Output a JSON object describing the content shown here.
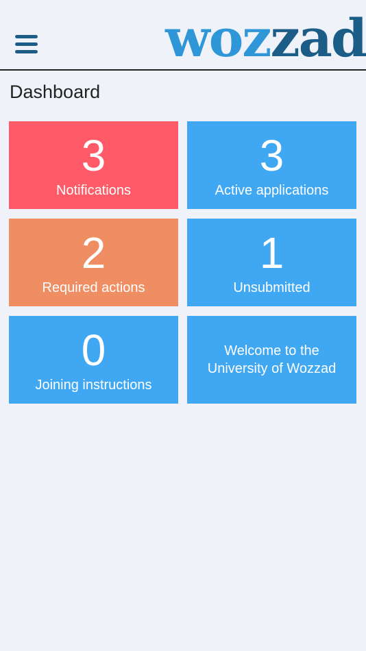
{
  "logo": {
    "part1": "woz",
    "part2": "zad"
  },
  "header": {
    "menu_icon": "hamburger-menu-icon"
  },
  "page": {
    "title": "Dashboard"
  },
  "colors": {
    "red": "#ff5a67",
    "orange": "#ef8d63",
    "blue": "#40a7f3",
    "logo_light": "#2f96d8",
    "logo_dark": "#1b5d86"
  },
  "tiles": [
    {
      "count": "3",
      "label": "Notifications",
      "color": "#ff5a67"
    },
    {
      "count": "3",
      "label": "Active applications",
      "color": "#40a7f3"
    },
    {
      "count": "2",
      "label": "Required actions",
      "color": "#ef8d63"
    },
    {
      "count": "1",
      "label": "Unsubmitted",
      "color": "#40a7f3"
    },
    {
      "count": "0",
      "label": "Joining instructions",
      "color": "#40a7f3"
    },
    {
      "welcome_line1": "Welcome to the",
      "welcome_line2": "University of Wozzad",
      "color": "#40a7f3"
    }
  ]
}
